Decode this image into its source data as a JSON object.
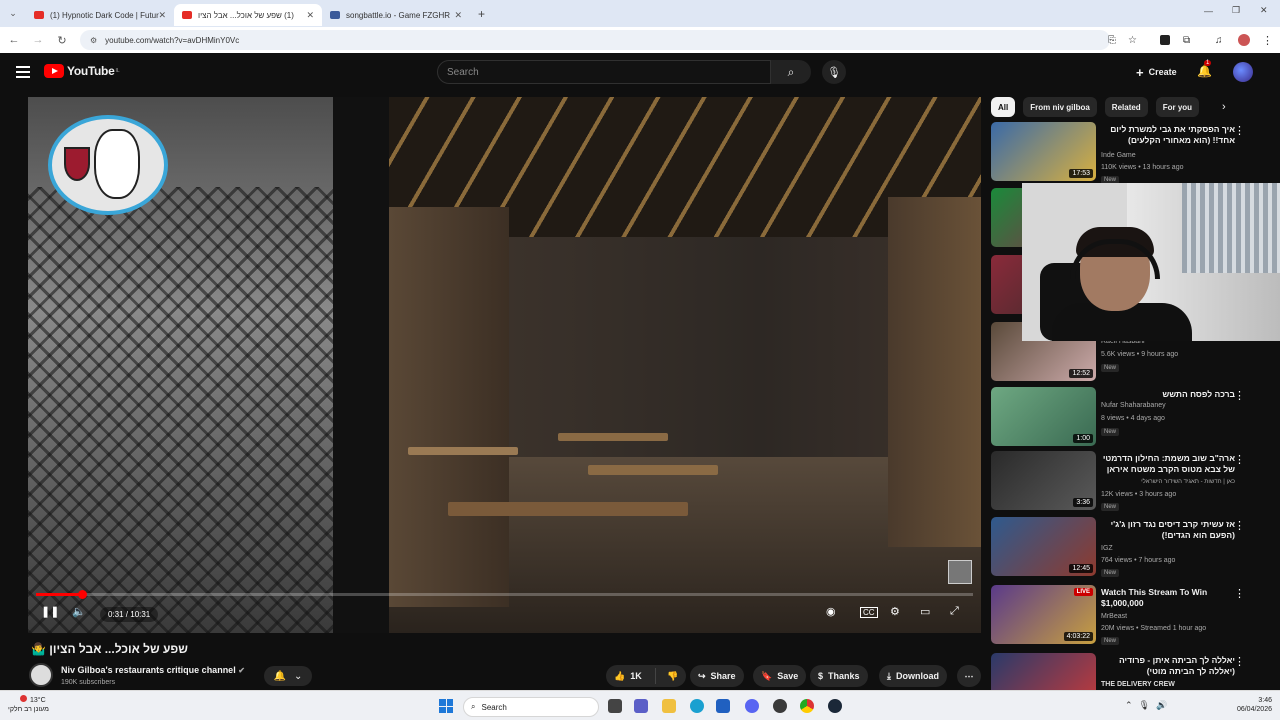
{
  "browser": {
    "tabs": [
      {
        "title": "(1) Hypnotic Dark Code | Futur",
        "color": "#e52d27",
        "active": false
      },
      {
        "title": "(1) שפע של אוכל... אבל הציו",
        "color": "#e52d27",
        "active": true
      },
      {
        "title": "songbattle.io - Game FZGHR",
        "color": "#3b5a9a",
        "active": false
      }
    ],
    "url": "youtube.com/watch?v=avDHMinY0Vc"
  },
  "header": {
    "logo_text": "YouTube",
    "logo_region": "IL",
    "search_placeholder": "Search",
    "create_label": "Create",
    "notification_count": "1"
  },
  "player": {
    "current_time": "0:31",
    "duration": "10:31",
    "time_display": "0:31 / 10:31",
    "progress": 0.049,
    "paused": false
  },
  "video": {
    "title": "שפע של אוכל... אבל הציון 🤷‍♂️",
    "channel_name": "Niv Gilboa's restaurants critique channel",
    "subscribers": "190K subscribers",
    "likes": "1K",
    "share_label": "Share",
    "save_label": "Save",
    "thanks_label": "Thanks",
    "download_label": "Download"
  },
  "chips": [
    "All",
    "From niv gilboa",
    "Related",
    "For you"
  ],
  "recommendations": [
    {
      "title": "איך הפסקתי את גבי למשרת ליום אחד!! (הוא מאחורי הקלעים)",
      "channel": "Inde Game",
      "meta": "110K views • 13 hours ago",
      "badge": "New",
      "duration": "17:53",
      "thumb": "#3a6aa8",
      "rtl": true
    },
    {
      "title": "",
      "channel": "Raeli Hasbani",
      "meta": "5.6K views • 9 hours ago",
      "badge": "New",
      "duration": "12:52",
      "thumb": "#5a4a3a",
      "rtl": true
    },
    {
      "title": "ברכה לפסח התשש",
      "channel": "Nufar Shaharabaney",
      "meta": "8 views • 4 days ago",
      "badge": "New",
      "duration": "1:00",
      "thumb": "#6ea882",
      "rtl": true
    },
    {
      "title": "ארה\"ב שוב משמת: החילון הדרמטי של צבא מטוס הקרב משטח איראן",
      "channel": "כאן | חדשות - תאגיד השידור הישראלי",
      "meta": "12K views • 3 hours ago",
      "badge": "New",
      "duration": "3:36",
      "thumb": "#2a2a2a",
      "rtl": true
    },
    {
      "title": "אז עשיתי קרב דיסים נגד רזון ג'ג'י (הפעם הוא הגדים!)",
      "channel": "IGZ",
      "meta": "764 views • 7 hours ago",
      "badge": "New",
      "duration": "12:45",
      "thumb": "#2e5a8e",
      "rtl": true
    },
    {
      "title": "Watch This Stream To Win $1,000,000",
      "channel": "MrBeast",
      "meta": "20M views • Streamed 1 hour ago",
      "badge": "New",
      "duration": "4:03:22",
      "live": "LIVE",
      "thumb": "#5a3a8a",
      "rtl": false
    },
    {
      "title": "יאללה לך הביתה איתן - פרודיה (יאללה לך הביתה מוטי)",
      "channel": "THE DELIVERY CREW",
      "meta": "",
      "badge": "",
      "duration": "",
      "thumb": "#2a3a6a",
      "rtl": true
    }
  ],
  "taskbar": {
    "temperature": "13°C",
    "weather_text": "מעונן רב חלקי",
    "search_label": "Search",
    "time": "3:46",
    "date": "06/04/2026"
  }
}
